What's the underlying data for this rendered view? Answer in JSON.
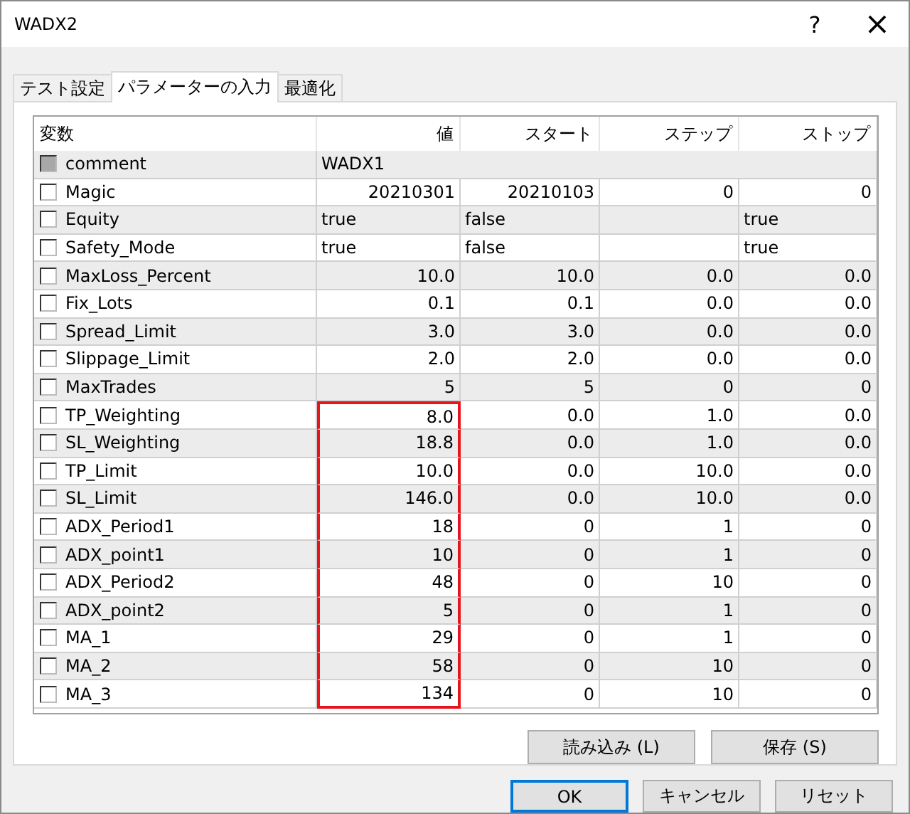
{
  "window": {
    "title": "WADX2",
    "help": "?",
    "close": "×"
  },
  "tabs": [
    {
      "label": "テスト設定",
      "selected": false
    },
    {
      "label": "パラメーターの入力",
      "selected": true
    },
    {
      "label": "最適化",
      "selected": false
    }
  ],
  "columns": [
    "変数",
    "値",
    "スタート",
    "ステップ",
    "ストップ"
  ],
  "rows": [
    {
      "kind": "string",
      "name": "comment",
      "checked": false,
      "disabled": true,
      "highlighted": false,
      "value": "WADX1"
    },
    {
      "kind": "number",
      "name": "Magic",
      "checked": false,
      "disabled": false,
      "highlighted": false,
      "value": "20210301",
      "start": "20210103",
      "step": "0",
      "stop": "0"
    },
    {
      "kind": "bool",
      "name": "Equity",
      "checked": false,
      "disabled": false,
      "highlighted": false,
      "value": "true",
      "start": "false",
      "stop": "true"
    },
    {
      "kind": "bool",
      "name": "Safety_Mode",
      "checked": false,
      "disabled": false,
      "highlighted": false,
      "value": "true",
      "start": "false",
      "stop": "true"
    },
    {
      "kind": "number",
      "name": "MaxLoss_Percent",
      "checked": false,
      "disabled": false,
      "highlighted": false,
      "value": "10.0",
      "start": "10.0",
      "step": "0.0",
      "stop": "0.0"
    },
    {
      "kind": "number",
      "name": "Fix_Lots",
      "checked": false,
      "disabled": false,
      "highlighted": false,
      "value": "0.1",
      "start": "0.1",
      "step": "0.0",
      "stop": "0.0"
    },
    {
      "kind": "number",
      "name": "Spread_Limit",
      "checked": false,
      "disabled": false,
      "highlighted": false,
      "value": "3.0",
      "start": "3.0",
      "step": "0.0",
      "stop": "0.0"
    },
    {
      "kind": "number",
      "name": "Slippage_Limit",
      "checked": false,
      "disabled": false,
      "highlighted": false,
      "value": "2.0",
      "start": "2.0",
      "step": "0.0",
      "stop": "0.0"
    },
    {
      "kind": "number",
      "name": "MaxTrades",
      "checked": false,
      "disabled": false,
      "highlighted": false,
      "value": "5",
      "start": "5",
      "step": "0",
      "stop": "0"
    },
    {
      "kind": "number",
      "name": "TP_Weighting",
      "checked": false,
      "disabled": false,
      "highlighted": true,
      "value": "8.0",
      "start": "0.0",
      "step": "1.0",
      "stop": "0.0"
    },
    {
      "kind": "number",
      "name": "SL_Weighting",
      "checked": false,
      "disabled": false,
      "highlighted": true,
      "value": "18.8",
      "start": "0.0",
      "step": "1.0",
      "stop": "0.0"
    },
    {
      "kind": "number",
      "name": "TP_Limit",
      "checked": false,
      "disabled": false,
      "highlighted": true,
      "value": "10.0",
      "start": "0.0",
      "step": "10.0",
      "stop": "0.0"
    },
    {
      "kind": "number",
      "name": "SL_Limit",
      "checked": false,
      "disabled": false,
      "highlighted": true,
      "value": "146.0",
      "start": "0.0",
      "step": "10.0",
      "stop": "0.0"
    },
    {
      "kind": "number",
      "name": "ADX_Period1",
      "checked": false,
      "disabled": false,
      "highlighted": true,
      "value": "18",
      "start": "0",
      "step": "1",
      "stop": "0"
    },
    {
      "kind": "number",
      "name": "ADX_point1",
      "checked": false,
      "disabled": false,
      "highlighted": true,
      "value": "10",
      "start": "0",
      "step": "1",
      "stop": "0"
    },
    {
      "kind": "number",
      "name": "ADX_Period2",
      "checked": false,
      "disabled": false,
      "highlighted": true,
      "value": "48",
      "start": "0",
      "step": "10",
      "stop": "0"
    },
    {
      "kind": "number",
      "name": "ADX_point2",
      "checked": false,
      "disabled": false,
      "highlighted": true,
      "value": "5",
      "start": "0",
      "step": "1",
      "stop": "0"
    },
    {
      "kind": "number",
      "name": "MA_1",
      "checked": false,
      "disabled": false,
      "highlighted": true,
      "value": "29",
      "start": "0",
      "step": "1",
      "stop": "0"
    },
    {
      "kind": "number",
      "name": "MA_2",
      "checked": false,
      "disabled": false,
      "highlighted": true,
      "value": "58",
      "start": "0",
      "step": "10",
      "stop": "0"
    },
    {
      "kind": "number",
      "name": "MA_3",
      "checked": false,
      "disabled": false,
      "highlighted": true,
      "value": "134",
      "start": "0",
      "step": "10",
      "stop": "0"
    }
  ],
  "panel_buttons": [
    "読み込み (L)",
    "保存 (S)"
  ],
  "dialog_buttons": [
    {
      "label": "OK",
      "selected": true
    },
    {
      "label": "キャンセル",
      "selected": false
    },
    {
      "label": "リセット",
      "selected": false
    }
  ]
}
